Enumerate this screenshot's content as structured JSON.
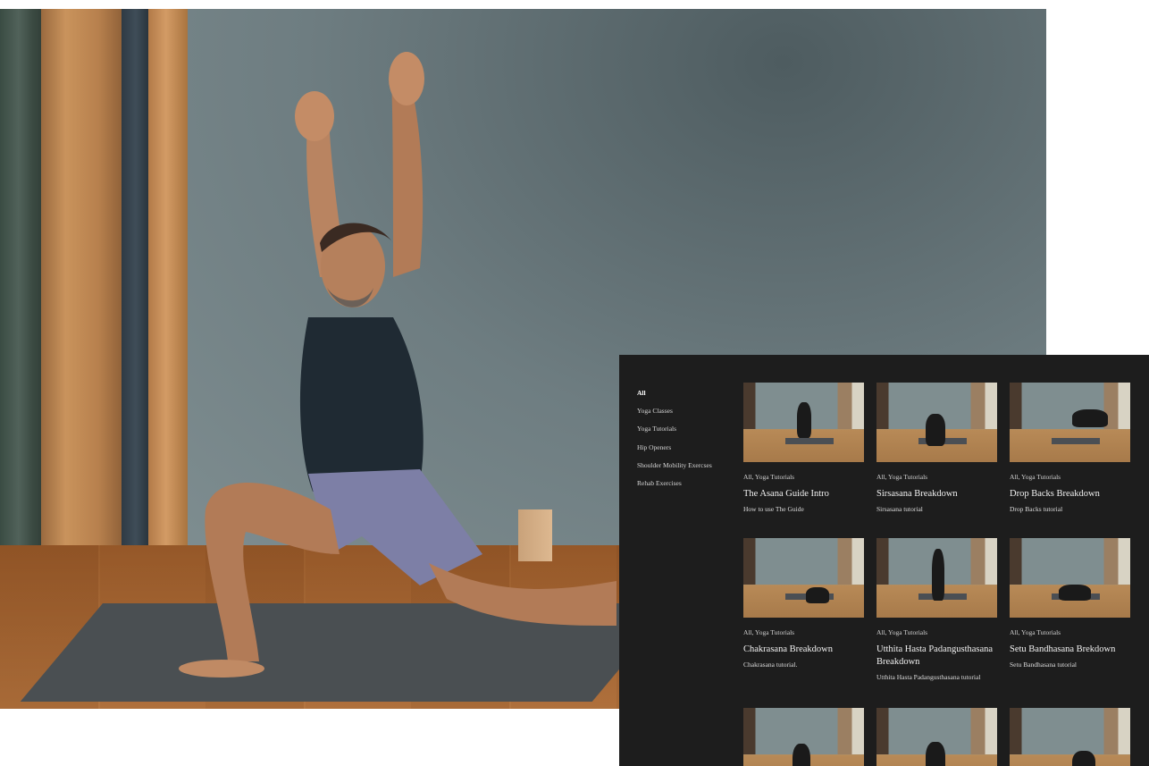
{
  "filters": [
    "All",
    "Yoga Classes",
    "Yoga Tutorials",
    "Hip Openers",
    "Shoulder Mobility Exercses",
    "Rehab Exercises"
  ],
  "active_filter": "All",
  "videos": [
    {
      "category": "All, Yoga Tutorials",
      "title": "The Asana Guide Intro",
      "subtitle": "How to use The Guide"
    },
    {
      "category": "All, Yoga Tutorials",
      "title": "Sirsasana Breakdown",
      "subtitle": "Sirsasana tutorial"
    },
    {
      "category": "All, Yoga Tutorials",
      "title": "Drop Backs Breakdown",
      "subtitle": "Drop Backs tutorial"
    },
    {
      "category": "All, Yoga Tutorials",
      "title": "Chakrasana Breakdown",
      "subtitle": "Chakrasana tutorial."
    },
    {
      "category": "All, Yoga Tutorials",
      "title": "Utthita Hasta Padangusthasana Breakdown",
      "subtitle": "Utthita Hasta Padangusthasana tutorial"
    },
    {
      "category": "All, Yoga Tutorials",
      "title": "Setu Bandhasana Brekdown",
      "subtitle": "Setu Bandhasana tutorial"
    },
    {
      "category": "",
      "title": "",
      "subtitle": ""
    },
    {
      "category": "",
      "title": "",
      "subtitle": ""
    },
    {
      "category": "",
      "title": "",
      "subtitle": ""
    }
  ]
}
